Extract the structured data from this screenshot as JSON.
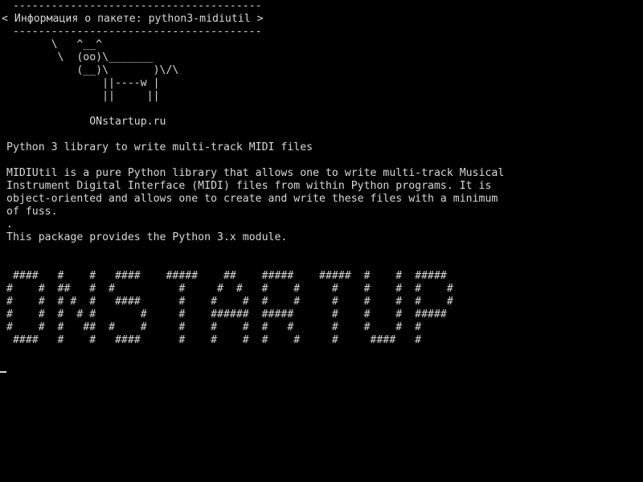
{
  "terminal": {
    "fg_color": "#d8d8d8",
    "bg_color": "#000000",
    "lines": [
      " ---------------------------------------",
      "< Информация о пакете: python3-midiutil >",
      " ---------------------------------------",
      "       \\   ^__^",
      "        \\  (oo)\\_______",
      "           (__)\\       )\\/\\",
      "               ||----w |",
      "               ||     ||",
      "",
      "             ONstartup.ru",
      "",
      "Python 3 library to write multi-track MIDI files",
      "",
      "MIDIUtil is a pure Python library that allows one to write multi-track Musical",
      "Instrument Digital Interface (MIDI) files from within Python programs. It is",
      "object-oriented and allows one to create and write these files with a minimum",
      "of fuss.",
      ".",
      "This package provides the Python 3.x module.",
      "",
      "",
      " ####   #    #   ####    #####    ##    #####    #####  #    #  #####",
      "#    #  ##   #  #          #     #  #   #    #     #    #    #  #    #",
      "#    #  # #  #   ####      #    #    #  #    #     #    #    #  #    #",
      "#    #  #  # #       #     #    ######  #####      #    #    #  #####",
      "#    #  #   ##  #    #     #    #    #  #   #      #    #    #  #",
      " ####   #    #   ####      #    #    #  #    #     #     ####   #",
      ""
    ]
  }
}
